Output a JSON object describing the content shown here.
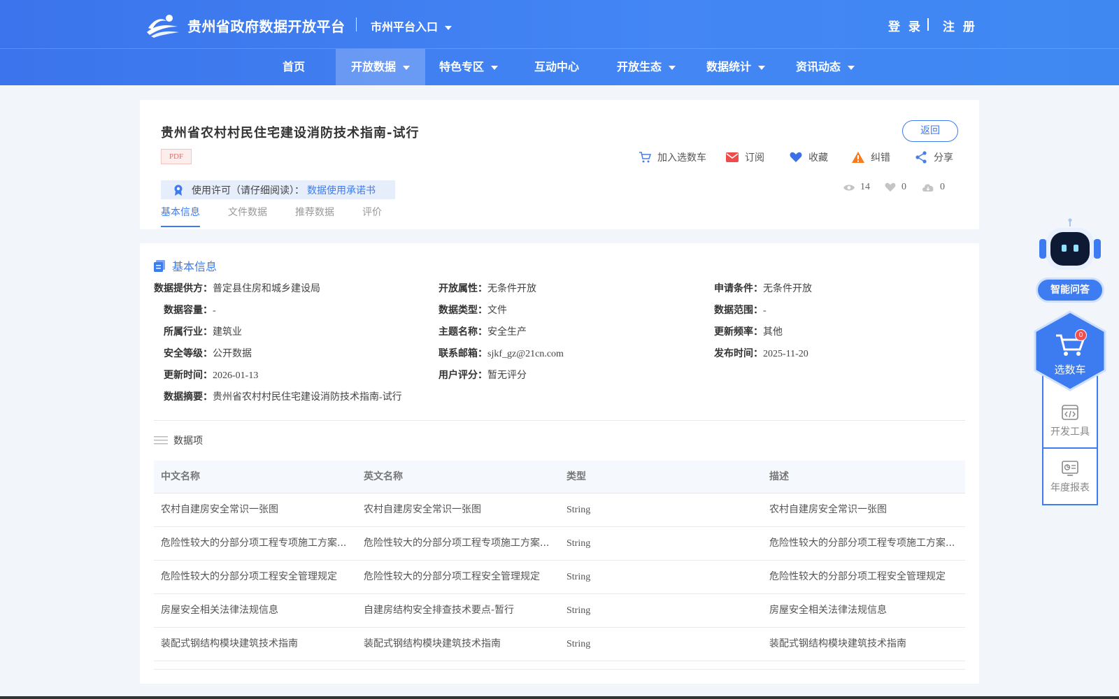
{
  "header": {
    "site_title": "贵州省政府数据开放平台",
    "city_entry": "市州平台入口",
    "login": "登 录",
    "register": "注 册"
  },
  "nav": {
    "items": [
      {
        "label": "首页",
        "dropdown": false
      },
      {
        "label": "开放数据",
        "dropdown": true,
        "active": true
      },
      {
        "label": "特色专区",
        "dropdown": true
      },
      {
        "label": "互动中心",
        "dropdown": false
      },
      {
        "label": "开放生态",
        "dropdown": true
      },
      {
        "label": "数据统计",
        "dropdown": true
      },
      {
        "label": "资讯动态",
        "dropdown": true
      }
    ]
  },
  "dataset": {
    "title": "贵州省农村村民住宅建设消防技术指南-试行",
    "format_tag": "PDF",
    "back_label": "返回",
    "actions": [
      {
        "label": "加入选数车",
        "icon": "cart-icon"
      },
      {
        "label": "订阅",
        "icon": "mail-icon"
      },
      {
        "label": "收藏",
        "icon": "heart-icon"
      },
      {
        "label": "纠错",
        "icon": "warning-icon"
      },
      {
        "label": "分享",
        "icon": "share-icon"
      }
    ],
    "license_label": "使用许可（请仔细阅读）：",
    "license_link": "数据使用承诺书",
    "stats": {
      "views": "14",
      "likes": "0",
      "downloads": "0"
    },
    "tabs": [
      "基本信息",
      "文件数据",
      "推荐数据",
      "评价"
    ]
  },
  "basic_info": {
    "section_title": "基本信息",
    "fields": [
      {
        "key": "数据提供方：",
        "value": "普定县住房和城乡建设局"
      },
      {
        "key": "开放属性：",
        "value": "无条件开放"
      },
      {
        "key": "申请条件：",
        "value": "无条件开放"
      },
      {
        "key": "数据容量：",
        "value": "-"
      },
      {
        "key": "数据类型：",
        "value": "文件"
      },
      {
        "key": "数据范围：",
        "value": "-"
      },
      {
        "key": "所属行业：",
        "value": "建筑业"
      },
      {
        "key": "主题名称：",
        "value": "安全生产"
      },
      {
        "key": "更新频率：",
        "value": "其他"
      },
      {
        "key": "安全等级：",
        "value": "公开数据"
      },
      {
        "key": "联系邮箱：",
        "value": "sjkf_gz@21cn.com"
      },
      {
        "key": "发布时间：",
        "value": "2025-11-20"
      },
      {
        "key": "更新时间：",
        "value": "2026-01-13"
      },
      {
        "key": "用户评分：",
        "value": "暂无评分"
      },
      {
        "key": "数据摘要：",
        "value": "贵州省农村村民住宅建设消防技术指南-试行"
      }
    ]
  },
  "data_items": {
    "section_title": "数据项",
    "columns": [
      "中文名称",
      "英文名称",
      "类型",
      "描述"
    ],
    "rows": [
      [
        "农村自建房安全常识一张图",
        "农村自建房安全常识一张图",
        "String",
        "农村自建房安全常识一张图"
      ],
      [
        "危险性较大的分部分项工程专项施工方案...",
        "危险性较大的分部分项工程专项施工方案...",
        "String",
        "危险性较大的分部分项工程专项施工方案..."
      ],
      [
        "危险性较大的分部分项工程安全管理规定",
        "危险性较大的分部分项工程安全管理规定",
        "String",
        "危险性较大的分部分项工程安全管理规定"
      ],
      [
        "房屋安全相关法律法规信息",
        "自建房结构安全排查技术要点-暂行",
        "String",
        "房屋安全相关法律法规信息"
      ],
      [
        "装配式钢结构模块建筑技术指南",
        "装配式钢结构模块建筑技术指南",
        "String",
        "装配式钢结构模块建筑技术指南"
      ]
    ]
  },
  "sidebar": {
    "ai_label": "智能问答",
    "cart_label": "选数车",
    "cart_count": "0",
    "dev_tools_label": "开发工具",
    "annual_report_label": "年度报表"
  },
  "colors": {
    "primary": "#3d7bf0",
    "header_gradient_start": "#3b74ec",
    "header_gradient_end": "#3f88f2"
  }
}
